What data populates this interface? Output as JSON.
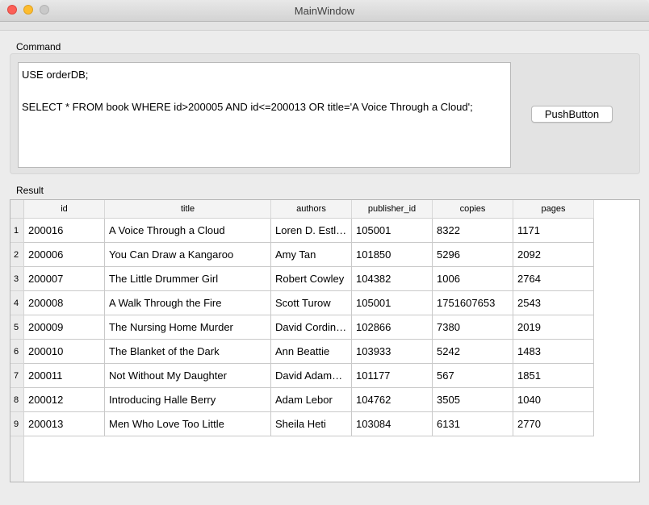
{
  "window": {
    "title": "MainWindow"
  },
  "command": {
    "label": "Command",
    "lines": [
      "USE orderDB;",
      "",
      "SELECT * FROM book WHERE id>200005 AND id<=200013 OR title='A Voice Through a Cloud';"
    ],
    "button_label": "PushButton"
  },
  "result": {
    "label": "Result",
    "columns": [
      "id",
      "title",
      "authors",
      "publisher_id",
      "copies",
      "pages"
    ],
    "row_numbers": [
      "1",
      "2",
      "3",
      "4",
      "5",
      "6",
      "7",
      "8",
      "9"
    ],
    "rows": [
      [
        "200016",
        "A Voice Through a Cloud",
        "Loren D. Estl…",
        "105001",
        "8322",
        "1171"
      ],
      [
        "200006",
        "You Can Draw a Kangaroo",
        "Amy Tan",
        "101850",
        "5296",
        "2092"
      ],
      [
        "200007",
        "The Little Drummer Girl",
        "Robert Cowley",
        "104382",
        "1006",
        "2764"
      ],
      [
        "200008",
        "A Walk Through the Fire",
        "Scott Turow",
        "105001",
        "1751607653",
        "2543"
      ],
      [
        "200009",
        "The Nursing Home Murder",
        "David Cordin…",
        "102866",
        "7380",
        "2019"
      ],
      [
        "200010",
        "The Blanket of the Dark",
        "Ann Beattie",
        "103933",
        "5242",
        "1483"
      ],
      [
        "200011",
        "Not Without My Daughter",
        "David Adam…",
        "101177",
        "567",
        "1851"
      ],
      [
        "200012",
        "Introducing Halle Berry",
        "Adam Lebor",
        "104762",
        "3505",
        "1040"
      ],
      [
        "200013",
        "Men Who Love Too Little",
        "Sheila Heti",
        "103084",
        "6131",
        "2770"
      ]
    ]
  }
}
